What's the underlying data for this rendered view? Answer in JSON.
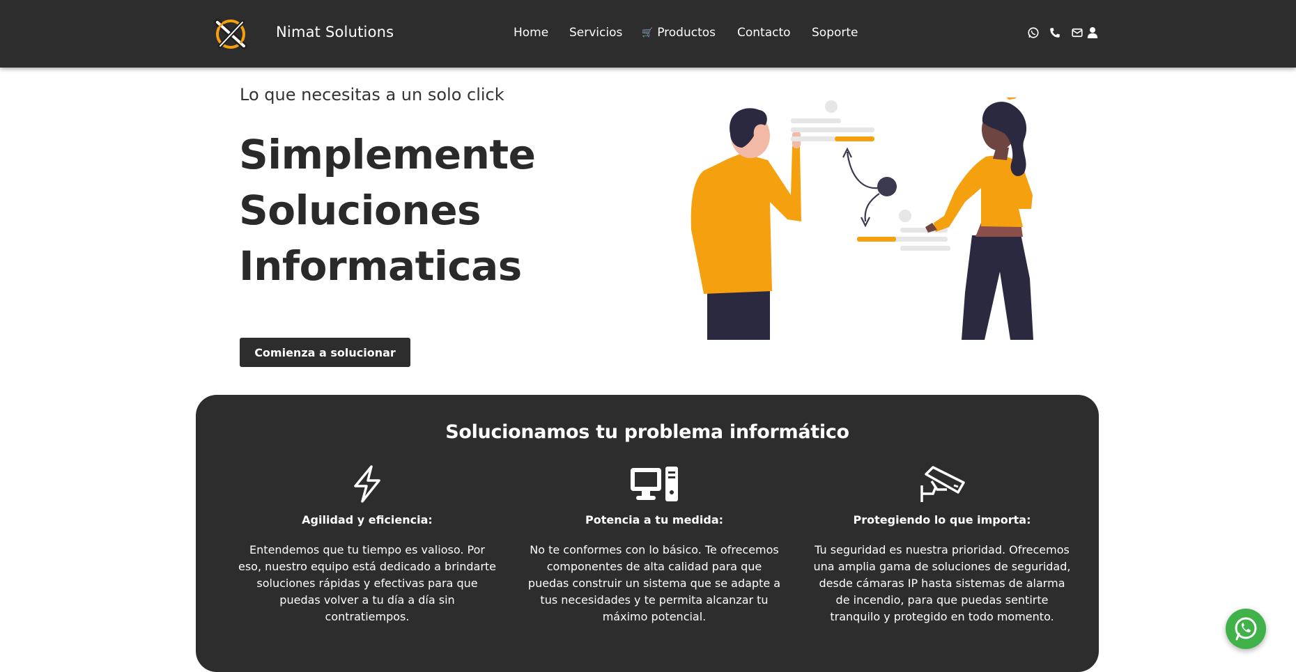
{
  "header": {
    "brand": "Nimat Solutions",
    "nav": [
      {
        "label": "Home"
      },
      {
        "label": "Servicios"
      },
      {
        "label": "Productos",
        "icon": "cart-icon"
      },
      {
        "label": "Contacto"
      },
      {
        "label": "Soporte"
      }
    ],
    "icons": [
      "whatsapp-icon",
      "phone-icon",
      "mail-icon",
      "user-icon"
    ]
  },
  "hero": {
    "tagline": "Lo que necesitas a un solo click",
    "title_lines": [
      "Simplemente",
      "Soluciones",
      "Informaticas"
    ],
    "cta_label": "Comienza a solucionar"
  },
  "features": {
    "title": "Solucionamos tu problema informático",
    "items": [
      {
        "icon": "lightning-icon",
        "title": "Agilidad y eficiencia:",
        "description": "Entendemos que tu tiempo es valioso. Por eso, nuestro equipo está dedicado a brindarte soluciones rápidas y efectivas para que puedas volver a tu día a día sin contratiempos."
      },
      {
        "icon": "desktop-computer-icon",
        "title": "Potencia a tu medida:",
        "description": "No te conformes con lo básico. Te ofrecemos componentes de alta calidad para que puedas construir un sistema que se adapte a tus necesidades y te permita alcanzar tu máximo potencial."
      },
      {
        "icon": "security-camera-icon",
        "title": "Protegiendo lo que importa:",
        "description": "Tu seguridad es nuestra prioridad. Ofrecemos una amplia gama de soluciones de seguridad, desde cámaras IP hasta sistemas de alarma de incendio, para que puedas sentirte tranquilo y protegido en todo momento."
      }
    ]
  },
  "floating": {
    "icon": "whatsapp-icon"
  },
  "colors": {
    "header_bg": "#2d2d2d",
    "accent_orange": "#f5a00f",
    "whatsapp_green": "#41b14a",
    "panel_bg": "#2d2d2d"
  }
}
